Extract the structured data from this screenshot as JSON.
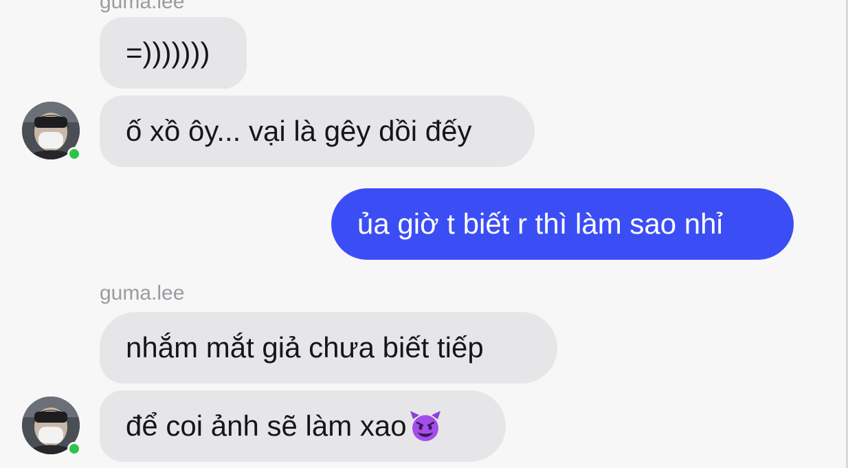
{
  "chat": {
    "partner_username": "guma.lee",
    "messages": [
      {
        "id": "m1",
        "direction": "incoming",
        "text": "=)))))))"
      },
      {
        "id": "m2",
        "direction": "incoming",
        "text": "ố xồ ôy... vại là gêy dồi đếy"
      },
      {
        "id": "m3",
        "direction": "outgoing",
        "text": "ủa giờ t biết r thì làm sao nhỉ"
      },
      {
        "id": "m4",
        "direction": "incoming",
        "text": "nhắm mắt giả chưa biết tiếp"
      },
      {
        "id": "m5",
        "direction": "incoming",
        "text": "để coi ảnh sẽ làm xao",
        "emoji": "smiling-devil-emoji"
      }
    ]
  },
  "colors": {
    "background": "#f7f7f8",
    "incoming_bubble": "#e6e6e8",
    "outgoing_bubble": "#3b4ef5",
    "online_status": "#2ec44a",
    "username_text": "#9a9aa0"
  }
}
